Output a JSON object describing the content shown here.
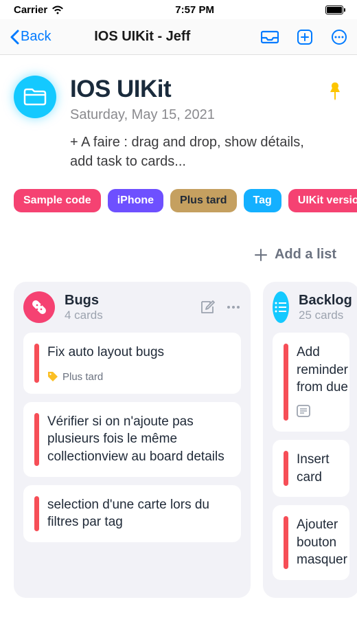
{
  "status": {
    "carrier": "Carrier",
    "time": "7:57 PM"
  },
  "nav": {
    "back": "Back",
    "title": "IOS UIKit - Jeff"
  },
  "board": {
    "title": "IOS UIKit",
    "date": "Saturday, May 15, 2021",
    "description": "+ A faire : drag and drop, show détails, add task to cards..."
  },
  "tags": [
    {
      "label": "Sample code",
      "bg": "#f54272",
      "fg": "#fff"
    },
    {
      "label": "iPhone",
      "bg": "#6e50ff",
      "fg": "#fff"
    },
    {
      "label": "Plus tard",
      "bg": "#c5a060",
      "fg": "#1f2937"
    },
    {
      "label": "Tag",
      "bg": "#14b0ff",
      "fg": "#fff"
    },
    {
      "label": "UIKit version",
      "bg": "#f54272",
      "fg": "#fff"
    }
  ],
  "addList": {
    "label": "Add a list"
  },
  "lists": [
    {
      "title": "Bugs",
      "count": "4 cards",
      "iconBg": "#f54272",
      "cards": [
        {
          "title": "Fix auto layout bugs",
          "bar": "#f64e57",
          "meta": "Plus tard"
        },
        {
          "title": "Vérifier si on n'ajoute pas plusieurs fois le même collectionview au board details",
          "bar": "#f64e57"
        },
        {
          "title": "selection d'une carte lors du filtres par tag",
          "bar": "#f64e57"
        }
      ]
    },
    {
      "title": "Backlog",
      "count": "25 cards",
      "iconBg": "#14c9ff",
      "cards": [
        {
          "title": "Add reminder from due",
          "bar": "#f64e57",
          "attach": true
        },
        {
          "title": "Insert card",
          "bar": "#f64e57"
        },
        {
          "title": "Ajouter bouton masquer",
          "bar": "#f64e57"
        }
      ]
    }
  ]
}
